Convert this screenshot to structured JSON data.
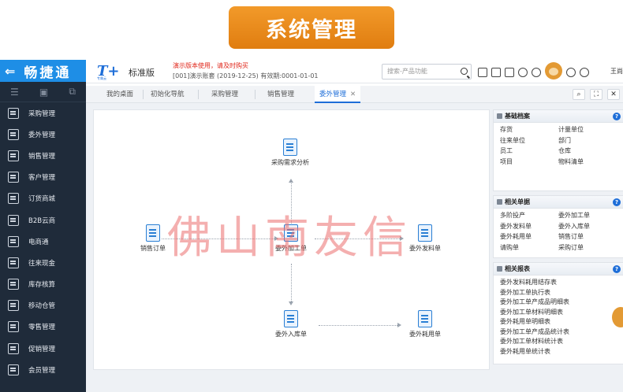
{
  "banner": {
    "title": "系统管理"
  },
  "sidebar": {
    "brand": "畅捷通",
    "items": [
      {
        "label": "采购管理"
      },
      {
        "label": "委外管理"
      },
      {
        "label": "销售管理"
      },
      {
        "label": "客户管理"
      },
      {
        "label": "订货商城"
      },
      {
        "label": "B2B云商"
      },
      {
        "label": "电商通"
      },
      {
        "label": "往来现金"
      },
      {
        "label": "库存核算"
      },
      {
        "label": "移动仓管"
      },
      {
        "label": "零售管理"
      },
      {
        "label": "促销管理"
      },
      {
        "label": "会员管理"
      }
    ]
  },
  "header": {
    "logo": "T+",
    "logo_sub": "专属云",
    "edition": "标准版",
    "warning": "演示版本使用，请及时购买",
    "account": "[001]演示账套    (2019-12-25)   有效期:0001-01-01",
    "search_placeholder": "搜索-产品功能",
    "user": "王尚"
  },
  "tabs": [
    {
      "label": "我的桌面"
    },
    {
      "label": "初始化导航"
    },
    {
      "label": "采购管理"
    },
    {
      "label": "销售管理"
    },
    {
      "label": "委外管理",
      "close": "✕"
    }
  ],
  "tab_tools": {
    "search": "⌕",
    "fullscreen": "⛶",
    "close": "✕"
  },
  "flow": {
    "nodes": {
      "purchase_analysis": "采购需求分析",
      "sales_order": "销售订单",
      "processing_order": "委外加工单",
      "issue_order": "委外发料单",
      "inbound_order": "委外入库单",
      "material_usage": "委外耗用单"
    },
    "watermark": "佛山南友信"
  },
  "panels": {
    "basic": {
      "title": "基础档案",
      "items": [
        "存货",
        "计量单位",
        "往来单位",
        "部门",
        "员工",
        "仓库",
        "项目",
        "物料清单"
      ]
    },
    "documents": {
      "title": "相关单据",
      "items": [
        "多阶投产",
        "委外加工单",
        "委外发料单",
        "委外入库单",
        "委外耗用单",
        "销售订单",
        "请购单",
        "采购订单"
      ]
    },
    "reports": {
      "title": "相关报表",
      "items": [
        "委外发料耗用结存表",
        "委外加工单执行表",
        "委外加工单产成品明细表",
        "委外加工单材料明细表",
        "委外耗用单明细表",
        "委外加工单产成品统计表",
        "委外加工单材料统计表",
        "委外耗用单统计表"
      ]
    },
    "help": "?"
  }
}
